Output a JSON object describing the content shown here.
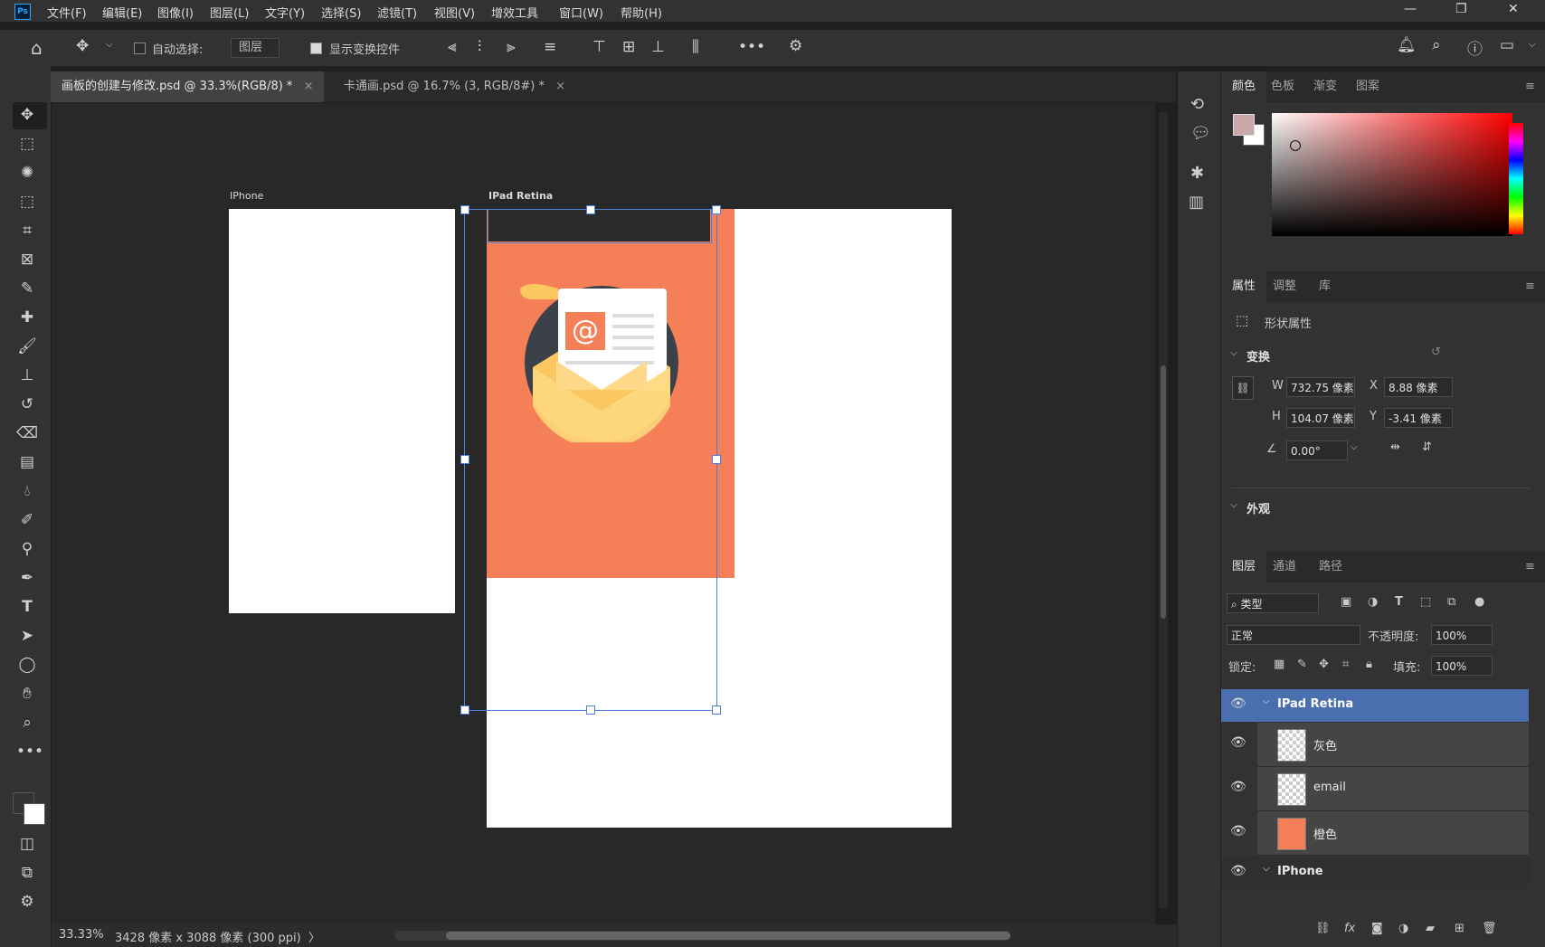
{
  "app": {
    "logo": "Ps"
  },
  "menu": [
    "文件(F)",
    "编辑(E)",
    "图像(I)",
    "图层(L)",
    "文字(Y)",
    "选择(S)",
    "滤镜(T)",
    "视图(V)",
    "增效工具",
    "窗口(W)",
    "帮助(H)"
  ],
  "window_controls": {
    "minimize": "—",
    "maximize": "❐",
    "close": "✕"
  },
  "options": {
    "auto_select_label": "自动选择:",
    "auto_select_checked": false,
    "auto_select_target": "图层",
    "show_transform_label": "显示变换控件",
    "show_transform_checked": true,
    "more": "•••"
  },
  "tabs": [
    {
      "label": "画板的创建与修改.psd @ 33.3%(RGB/8) *",
      "active": true,
      "close": "×"
    },
    {
      "label": "卡通画.psd @ 16.7% (3, RGB/8#) *",
      "active": false,
      "close": "×"
    }
  ],
  "artboards": {
    "iphone_label": "IPhone",
    "ipad_label": "IPad Retina"
  },
  "status": {
    "zoom": "33.33%",
    "doc_info": "3428 像素 x 3088 像素 (300 ppi)",
    "arrow": "〉"
  },
  "color_panel": {
    "tabs": [
      "颜色",
      "色板",
      "渐变",
      "图案"
    ],
    "active": "颜色",
    "fg": "#c8a8a8",
    "bg": "#ffffff"
  },
  "properties_panel": {
    "tabs": [
      "属性",
      "调整",
      "库"
    ],
    "active": "属性",
    "section_title": "形状属性",
    "transform_heading": "变换",
    "w_label": "W",
    "w_value": "732.75 像素",
    "h_label": "H",
    "h_value": "104.07 像素",
    "x_label": "X",
    "x_value": "8.88 像素",
    "y_label": "Y",
    "y_value": "-3.41 像素",
    "angle_value": "0.00°",
    "appearance_heading": "外观"
  },
  "layers_panel": {
    "tabs": [
      "图层",
      "通道",
      "路径"
    ],
    "active": "图层",
    "filter_label": "类型",
    "blend_mode": "正常",
    "opacity_label": "不透明度:",
    "opacity_value": "100%",
    "lock_label": "锁定:",
    "fill_label": "填充:",
    "fill_value": "100%",
    "layers": [
      {
        "name": "IPad Retina",
        "type": "artboard",
        "expanded": true,
        "selected": true
      },
      {
        "name": "灰色",
        "type": "shape"
      },
      {
        "name": "email",
        "type": "smart"
      },
      {
        "name": "橙色",
        "type": "smart"
      },
      {
        "name": "IPhone",
        "type": "artboard",
        "expanded": true
      }
    ]
  },
  "colors": {
    "accent": "#4b6eaf",
    "orange": "#f57f57",
    "selection": "#4a7fe0",
    "dark_bar": "#2b2b2b"
  }
}
